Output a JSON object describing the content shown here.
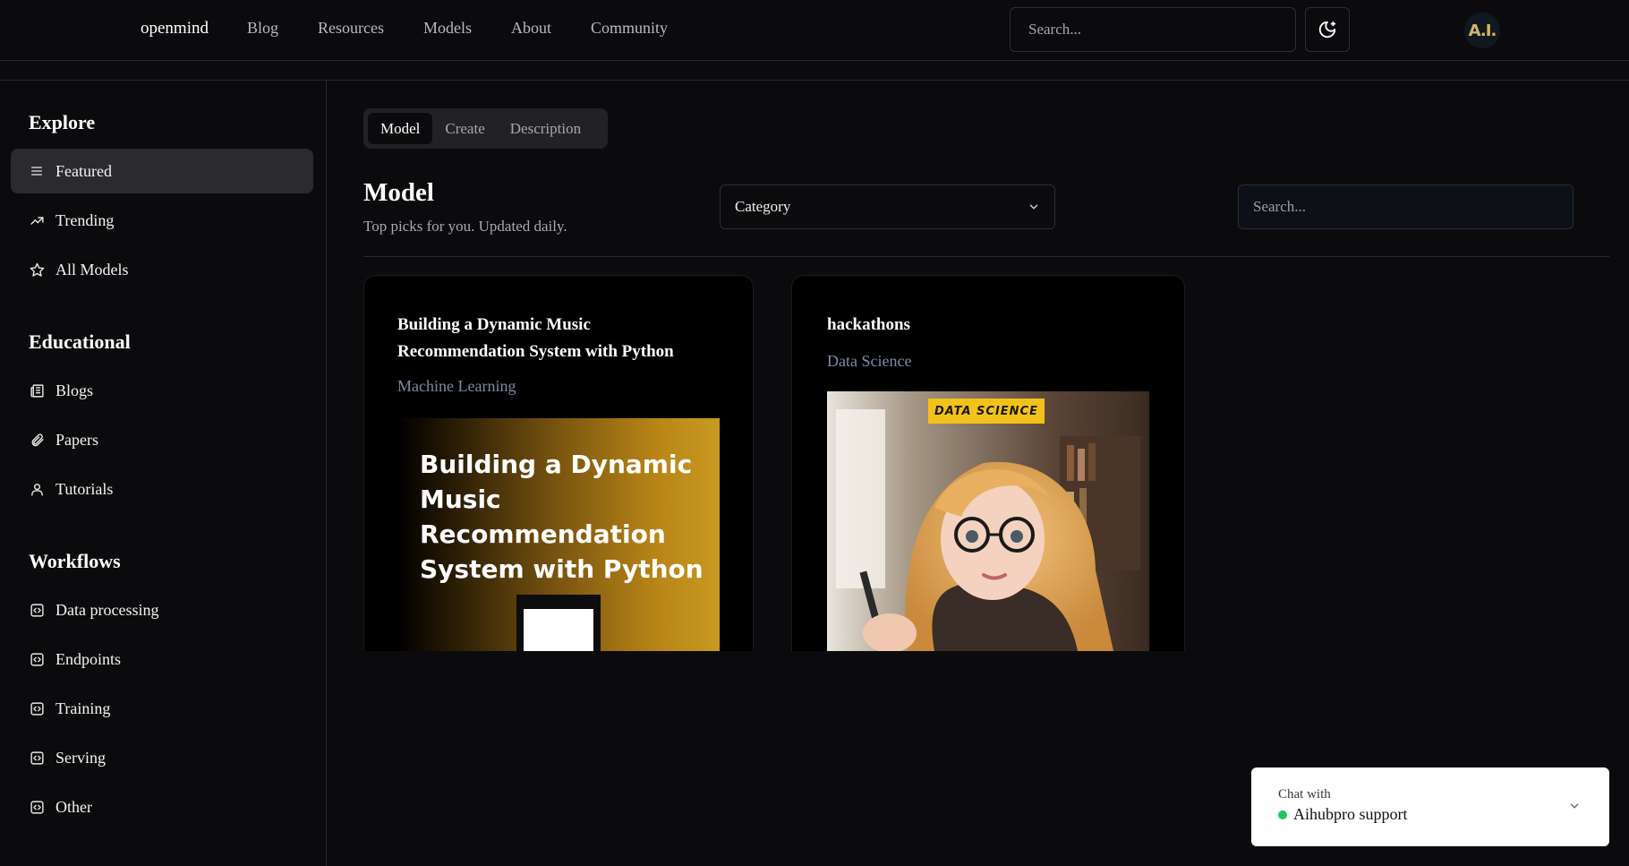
{
  "header": {
    "brand": "openmind",
    "nav": [
      "Blog",
      "Resources",
      "Models",
      "About",
      "Community"
    ],
    "search_placeholder": "Search...",
    "theme_icon": "moon-stars-icon",
    "avatar_text": "A.I."
  },
  "sidebar": {
    "sections": [
      {
        "heading": "Explore",
        "items": [
          {
            "label": "Featured",
            "icon": "list-icon"
          },
          {
            "label": "Trending",
            "icon": "trending-up-icon"
          },
          {
            "label": "All Models",
            "icon": "star-icon"
          }
        ]
      },
      {
        "heading": "Educational",
        "items": [
          {
            "label": "Blogs",
            "icon": "newspaper-icon"
          },
          {
            "label": "Papers",
            "icon": "paperclip-icon"
          },
          {
            "label": "Tutorials",
            "icon": "user-icon"
          }
        ]
      },
      {
        "heading": "Workflows",
        "items": [
          {
            "label": "Data processing",
            "icon": "code-square-icon"
          },
          {
            "label": "Endpoints",
            "icon": "code-square-icon"
          },
          {
            "label": "Training",
            "icon": "code-square-icon"
          },
          {
            "label": "Serving",
            "icon": "code-square-icon"
          },
          {
            "label": "Other",
            "icon": "code-square-icon"
          }
        ]
      }
    ],
    "active_item": "Featured"
  },
  "main": {
    "tabs": [
      "Model",
      "Create",
      "Description"
    ],
    "active_tab": "Model",
    "title": "Model",
    "subtitle": "Top picks for you. Updated daily.",
    "category_label": "Category",
    "search_placeholder": "Search...",
    "cards": [
      {
        "title_line1": "Building a Dynamic Music",
        "title_line2": "Recommendation System with Python",
        "category": "Machine Learning",
        "image_text": "Building a Dynamic Music Recommendation System with Python"
      },
      {
        "title_line1": "hackathons",
        "category": "Data Science",
        "image_badge": "DATA SCIENCE"
      }
    ]
  },
  "chat": {
    "small": "Chat with",
    "name": "Aihubpro support",
    "status_color": "#22c55e"
  },
  "colors": {
    "background": "#0b0b0d",
    "active_item": "#2b2b2f",
    "category_text": "#7f8aa3",
    "badge": "#f3c21a"
  }
}
